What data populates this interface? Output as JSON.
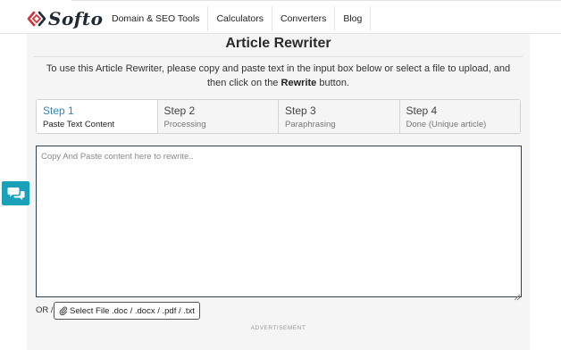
{
  "brand": {
    "name": "Softo",
    "logo_icon": "code-brackets-icon"
  },
  "nav": {
    "items": [
      {
        "label": "Domain & SEO Tools"
      },
      {
        "label": "Calculators"
      },
      {
        "label": "Converters"
      },
      {
        "label": "Blog"
      }
    ]
  },
  "page": {
    "title": "Article Rewriter",
    "intro_prefix": "To use this Article Rewriter, please copy and paste text in the input box below or select a file to upload, and then click on the",
    "intro_bold": "Rewrite",
    "intro_suffix": "button."
  },
  "steps": [
    {
      "num": "Step 1",
      "desc": "Paste Text Content",
      "active": true
    },
    {
      "num": "Step 2",
      "desc": "Processing",
      "active": false
    },
    {
      "num": "Step 3",
      "desc": "Paraphrasing",
      "active": false
    },
    {
      "num": "Step 4",
      "desc": "Done (Unique article)",
      "active": false
    }
  ],
  "editor": {
    "placeholder": "Copy And Paste content here to rewrite..",
    "value": ""
  },
  "file_select": {
    "or_label": "OR /",
    "button_label": "Select File .doc / .docx / .pdf / .txt",
    "icon": "paperclip-icon"
  },
  "ad": {
    "label": "ADVERTISEMENT"
  },
  "chat": {
    "icon": "chat-bubbles-icon"
  },
  "colors": {
    "accent": "#2b88c8",
    "chat_button": "#1aa0b8",
    "logo_red": "#d9303a",
    "panel_bg": "#f5f5f5"
  }
}
